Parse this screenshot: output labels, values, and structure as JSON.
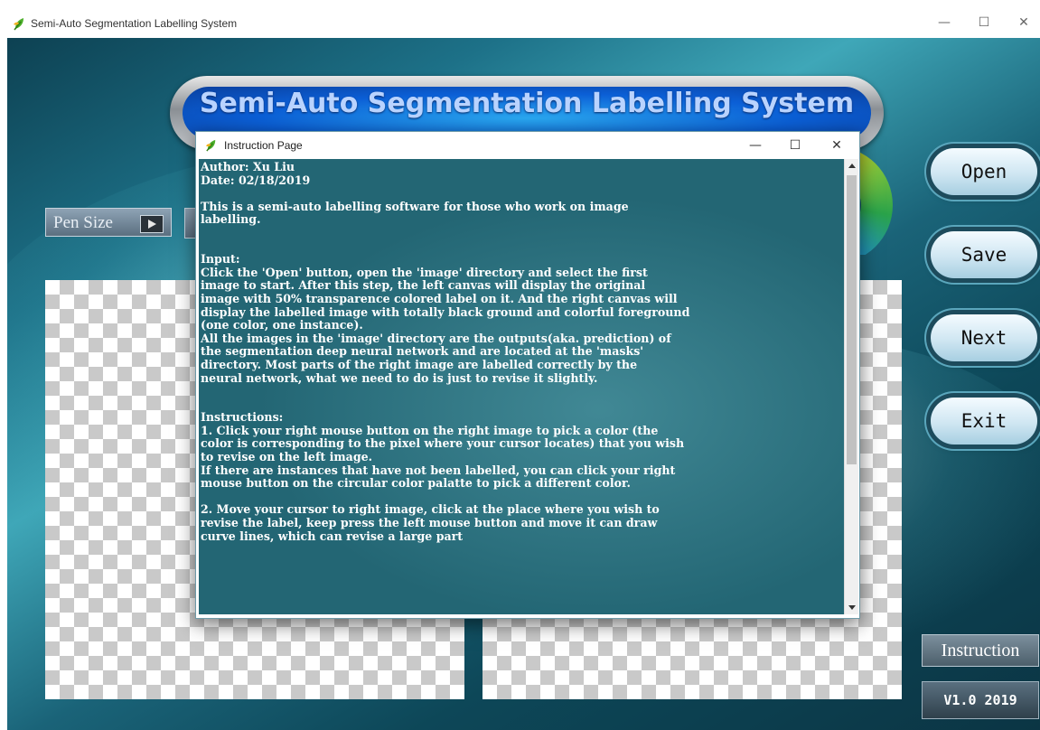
{
  "window": {
    "title": "Semi-Auto Segmentation Labelling System",
    "controls": {
      "minimize": "—",
      "maximize": "☐",
      "close": "✕"
    }
  },
  "banner": {
    "title": "Semi-Auto Segmentation Labelling System"
  },
  "left_controls": {
    "pen_size_label": "Pen Size"
  },
  "side_buttons": {
    "open": "Open",
    "save": "Save",
    "next": "Next",
    "exit": "Exit"
  },
  "bottom_buttons": {
    "instruction": "Instruction",
    "version": "V1.0 2019"
  },
  "dialog": {
    "title": "Instruction Page",
    "controls": {
      "minimize": "—",
      "maximize": "☐",
      "close": "✕"
    },
    "text": "Author: Xu Liu\nDate: 02/18/2019\n\nThis is a semi-auto labelling software for those who work on image\nlabelling.\n\n\nInput:\nClick the 'Open' button, open the 'image' directory and select the first\nimage to start. After this step, the left canvas will display the original\nimage with 50% transparence colored label on it. And the right canvas will\ndisplay the labelled image with totally black ground and colorful foreground\n(one color, one instance).\nAll the images in the 'image' directory are the outputs(aka. prediction) of\nthe segmentation deep neural network and are located at the 'masks'\ndirectory. Most parts of the right image are labelled correctly by the\nneural network, what we need to do is just to revise it slightly.\n\n\nInstructions:\n1. Click your right mouse button on the right image to pick a color (the\ncolor is corresponding to the pixel where your cursor locates) that you wish\nto revise on the left image.\nIf there are instances that have not been labelled, you can click your right\nmouse button on the circular color palatte to pick a different color.\n\n2. Move your cursor to right image, click at the place where you wish to\nrevise the label, keep press the left mouse button and move it can draw\ncurve lines, which can revise a large part"
  },
  "icons": {
    "app": "leaf-icon",
    "dialog": "leaf-icon"
  }
}
